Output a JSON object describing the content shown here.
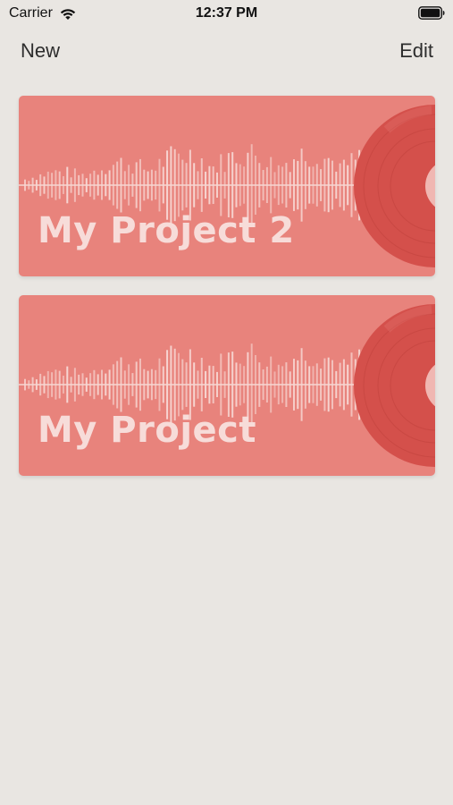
{
  "status_bar": {
    "carrier": "Carrier",
    "time": "12:37 PM"
  },
  "nav": {
    "new_label": "New",
    "edit_label": "Edit"
  },
  "projects": [
    {
      "title": "My Project 2"
    },
    {
      "title": "My Project"
    }
  ],
  "colors": {
    "background": "#e9e6e2",
    "card": "#e8837c",
    "record": "#d4504b",
    "record_label": "#f0b7b2"
  },
  "icons": [
    "wifi-icon",
    "battery-icon",
    "waveform-icon",
    "vinyl-record-icon"
  ]
}
